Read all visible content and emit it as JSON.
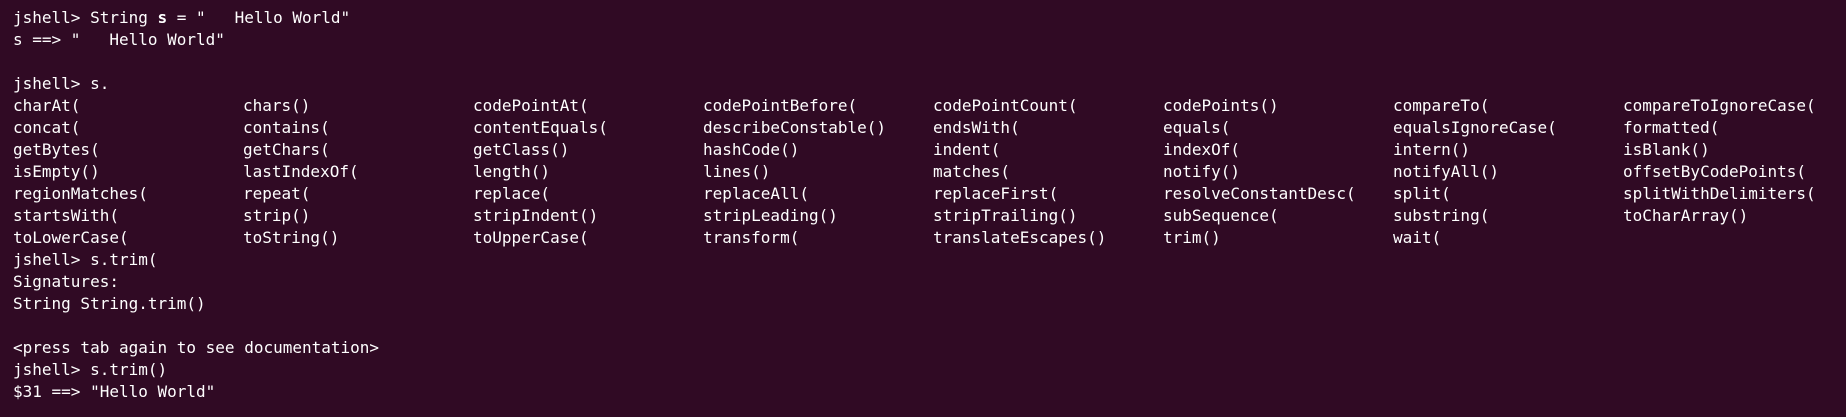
{
  "terminal": {
    "lines_top": [
      {
        "prompt": "jshell>",
        "cmd_pre": " String ",
        "cmd_bold": "s",
        "cmd_post": " = \"   Hello World\""
      },
      {
        "text": "s ==> \"   Hello World\""
      },
      {
        "text": ""
      },
      {
        "prompt": "jshell>",
        "cmd": " s."
      }
    ],
    "completions": [
      [
        "charAt(",
        "chars()",
        "codePointAt(",
        "codePointBefore(",
        "codePointCount(",
        "codePoints()",
        "compareTo(",
        "compareToIgnoreCase("
      ],
      [
        "concat(",
        "contains(",
        "contentEquals(",
        "describeConstable()",
        "endsWith(",
        "equals(",
        "equalsIgnoreCase(",
        "formatted("
      ],
      [
        "getBytes(",
        "getChars(",
        "getClass()",
        "hashCode()",
        "indent(",
        "indexOf(",
        "intern()",
        "isBlank()"
      ],
      [
        "isEmpty()",
        "lastIndexOf(",
        "length()",
        "lines()",
        "matches(",
        "notify()",
        "notifyAll()",
        "offsetByCodePoints("
      ],
      [
        "regionMatches(",
        "repeat(",
        "replace(",
        "replaceAll(",
        "replaceFirst(",
        "resolveConstantDesc(",
        "split(",
        "splitWithDelimiters("
      ],
      [
        "startsWith(",
        "strip()",
        "stripIndent()",
        "stripLeading()",
        "stripTrailing()",
        "subSequence(",
        "substring(",
        "toCharArray()"
      ],
      [
        "toLowerCase(",
        "toString()",
        "toUpperCase(",
        "transform(",
        "translateEscapes()",
        "trim()",
        "wait(",
        ""
      ]
    ],
    "lines_bottom": [
      {
        "prompt": "jshell>",
        "cmd": " s.trim("
      },
      {
        "text": "Signatures:"
      },
      {
        "text": "String String.trim()"
      },
      {
        "text": ""
      },
      {
        "text": "<press tab again to see documentation>"
      },
      {
        "prompt": "jshell>",
        "cmd": " s.trim()"
      },
      {
        "text": "$31 ==> \"Hello World\""
      }
    ]
  }
}
